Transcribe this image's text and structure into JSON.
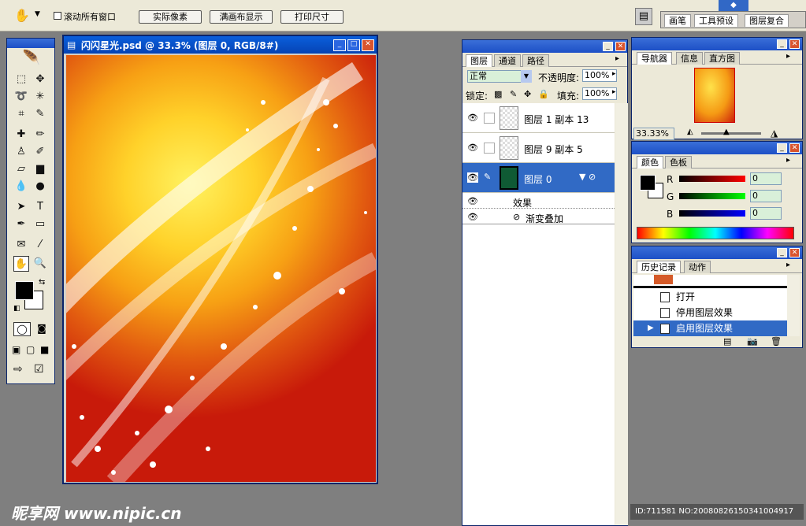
{
  "options_bar": {
    "scroll_all_label": "滚动所有窗口",
    "actual_pixels": "实际像素",
    "fit_screen": "满画布显示",
    "print_size": "打印尺寸",
    "dock_tabs": [
      "画笔",
      "工具预设",
      "图层复合"
    ]
  },
  "document": {
    "title": "闪闪星光.psd @ 33.3% (图层 0, RGB/8#)"
  },
  "layers_panel": {
    "tabs": [
      "图层",
      "通道",
      "路径"
    ],
    "blend_mode": "正常",
    "opacity_label": "不透明度:",
    "opacity_value": "100%",
    "lock_label": "锁定:",
    "fill_label": "填充:",
    "fill_value": "100%",
    "layers": [
      {
        "name": "图层 1 副本 13"
      },
      {
        "name": "图层 9 副本 5"
      },
      {
        "name": "图层 0"
      }
    ],
    "effects_label": "效果",
    "effect_item": "渐变叠加"
  },
  "navigator_panel": {
    "tabs": [
      "导航器",
      "信息",
      "直方图"
    ],
    "zoom": "33.33%"
  },
  "color_panel": {
    "tabs": [
      "颜色",
      "色板"
    ],
    "channels": [
      {
        "label": "R",
        "value": "0"
      },
      {
        "label": "G",
        "value": "0"
      },
      {
        "label": "B",
        "value": "0"
      }
    ]
  },
  "history_panel": {
    "tabs": [
      "历史记录",
      "动作"
    ],
    "items": [
      "打开",
      "停用图层效果",
      "启用图层效果"
    ]
  },
  "watermark": {
    "site": "昵享网 www.nipic.cn",
    "id": "ID:711581 NO:20080826150341004917"
  }
}
